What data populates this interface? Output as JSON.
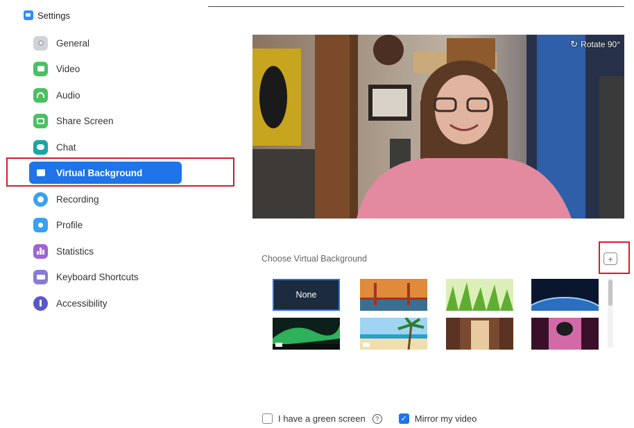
{
  "window": {
    "title": "Settings"
  },
  "sidebar": {
    "items": [
      {
        "label": "General",
        "icon": "gear-icon",
        "color": "#d0d3d8"
      },
      {
        "label": "Video",
        "icon": "video-camera-icon",
        "color": "#4cbf63"
      },
      {
        "label": "Audio",
        "icon": "headphones-icon",
        "color": "#4cbf63"
      },
      {
        "label": "Share Screen",
        "icon": "share-screen-icon",
        "color": "#4cbf63"
      },
      {
        "label": "Chat",
        "icon": "chat-icon",
        "color": "#1fa3a5"
      },
      {
        "label": "Virtual Background",
        "icon": "virtual-background-icon",
        "color": "#1e74e8",
        "active": true
      },
      {
        "label": "Recording",
        "icon": "recording-icon",
        "color": "#3aa0f0"
      },
      {
        "label": "Profile",
        "icon": "profile-icon",
        "color": "#3aa0f0"
      },
      {
        "label": "Statistics",
        "icon": "statistics-icon",
        "color": "#a064d4"
      },
      {
        "label": "Keyboard Shortcuts",
        "icon": "keyboard-icon",
        "color": "#8a7bd6"
      },
      {
        "label": "Accessibility",
        "icon": "accessibility-icon",
        "color": "#5b57c9"
      }
    ]
  },
  "preview": {
    "rotate_label": "Rotate 90°"
  },
  "background_picker": {
    "label": "Choose Virtual Background",
    "add_icon": "plus-icon",
    "thumbnails": [
      {
        "name": "none",
        "label": "None",
        "selected": true
      },
      {
        "name": "golden-gate-bridge"
      },
      {
        "name": "grass"
      },
      {
        "name": "earth-from-space"
      },
      {
        "name": "aurora",
        "video": true
      },
      {
        "name": "beach-palm",
        "video": true
      },
      {
        "name": "hallway-room"
      },
      {
        "name": "purple-stage"
      }
    ]
  },
  "options": {
    "green_screen": {
      "label": "I have a green screen",
      "checked": false
    },
    "mirror_video": {
      "label": "Mirror my video",
      "checked": true
    }
  }
}
